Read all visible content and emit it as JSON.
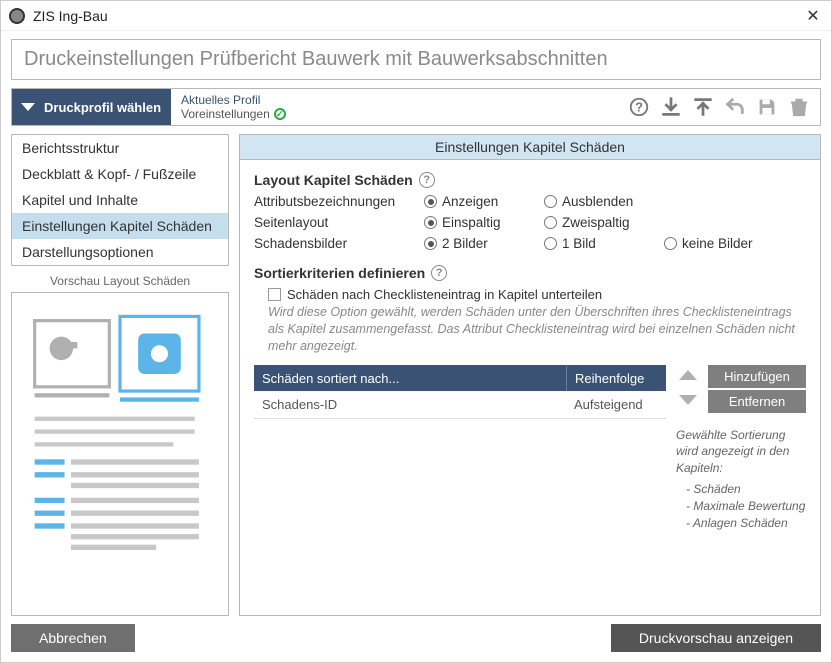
{
  "window": {
    "title": "ZIS Ing-Bau"
  },
  "header": {
    "banner": "Druckeinstellungen Prüfbericht Bauwerk mit Bauwerksabschnitten"
  },
  "profile": {
    "picker_label": "Druckprofil wählen",
    "current_label": "Aktuelles Profil",
    "current_value": "Voreinstellungen"
  },
  "toolbar_icons": {
    "help": "help-icon",
    "download": "download-icon",
    "upload": "upload-icon",
    "undo": "undo-icon",
    "save": "save-icon",
    "delete": "trash-icon"
  },
  "nav": {
    "items": [
      {
        "label": "Berichtsstruktur",
        "selected": false
      },
      {
        "label": "Deckblatt & Kopf- / Fußzeile",
        "selected": false
      },
      {
        "label": "Kapitel und Inhalte",
        "selected": false
      },
      {
        "label": "Einstellungen Kapitel Schäden",
        "selected": true
      },
      {
        "label": "Darstellungsoptionen",
        "selected": false
      }
    ]
  },
  "preview": {
    "label": "Vorschau Layout Schäden"
  },
  "panel": {
    "title": "Einstellungen Kapitel Schäden",
    "section_layout": "Layout Kapitel Schäden",
    "rows": {
      "attr": {
        "label": "Attributsbezeichnungen",
        "opts": [
          "Anzeigen",
          "Ausblenden"
        ],
        "value": "Anzeigen"
      },
      "layout": {
        "label": "Seitenlayout",
        "opts": [
          "Einspaltig",
          "Zweispaltig"
        ],
        "value": "Einspaltig"
      },
      "images": {
        "label": "Schadensbilder",
        "opts": [
          "2 Bilder",
          "1 Bild",
          "keine Bilder"
        ],
        "value": "2 Bilder"
      }
    },
    "section_sort": "Sortierkriterien definieren",
    "subcapitel": {
      "checked": false,
      "label": "Schäden nach Checklisteneintrag in Kapitel unterteilen",
      "hint": "Wird diese Option gewählt, werden Schäden unter den Überschriften ihres Checklisteneintrags als Kapitel zusammengefasst. Das Attribut Checklisteneintrag wird bei einzelnen Schäden nicht mehr angezeigt."
    },
    "sort_table": {
      "header": {
        "col1": "Schäden sortiert nach...",
        "col2": "Reihenfolge"
      },
      "rows": [
        {
          "col1": "Schadens-ID",
          "col2": "Aufsteigend"
        }
      ]
    },
    "sort_actions": {
      "add": "Hinzufügen",
      "remove": "Entfernen"
    },
    "sort_note": {
      "intro": "Gewählte Sortierung wird angezeigt in den Kapiteln:",
      "items": [
        "Schäden",
        "Maximale Bewertung",
        "Anlagen Schäden"
      ]
    }
  },
  "footer": {
    "cancel": "Abbrechen",
    "preview": "Druckvorschau anzeigen"
  }
}
